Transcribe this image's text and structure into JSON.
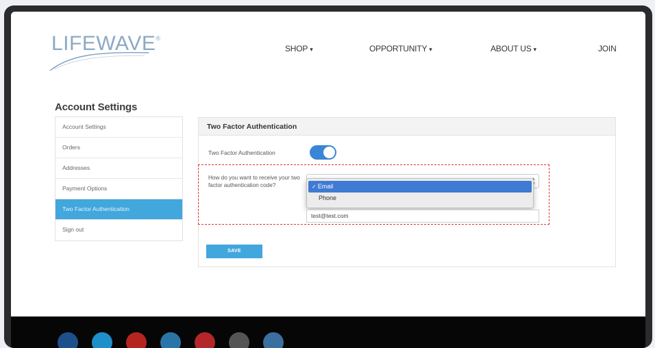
{
  "brand": {
    "logo_text": "LIFEWAVE",
    "logo_mark": "®"
  },
  "nav": {
    "items": [
      {
        "label": "SHOP",
        "caret": "▾"
      },
      {
        "label": "OPPORTUNITY",
        "caret": "▾"
      },
      {
        "label": "ABOUT US",
        "caret": "▾"
      },
      {
        "label": "JOIN",
        "caret": ""
      }
    ]
  },
  "page": {
    "title": "Account Settings"
  },
  "sidebar": {
    "items": [
      {
        "label": "Account Settings"
      },
      {
        "label": "Orders"
      },
      {
        "label": "Addresses"
      },
      {
        "label": "Payment Options"
      },
      {
        "label": "Two Factor Authentication"
      },
      {
        "label": "Sign out"
      }
    ]
  },
  "panel": {
    "title": "Two Factor Authentication",
    "toggle_label": "Two Factor Authentication",
    "toggle_on": true,
    "question": "How do you want to receive your two factor authentication code?",
    "dropdown": {
      "options": [
        "Email",
        "Phone"
      ],
      "selected": "Email",
      "check": "✓"
    },
    "email_value": "test@test.com",
    "save_label": "SAVE"
  },
  "colors": {
    "accent": "#41a7dc",
    "toggle": "#3a86d6",
    "dropdown_highlight": "#3f7ad3",
    "highlight_border": "#e0332d",
    "footer": "#060606"
  }
}
